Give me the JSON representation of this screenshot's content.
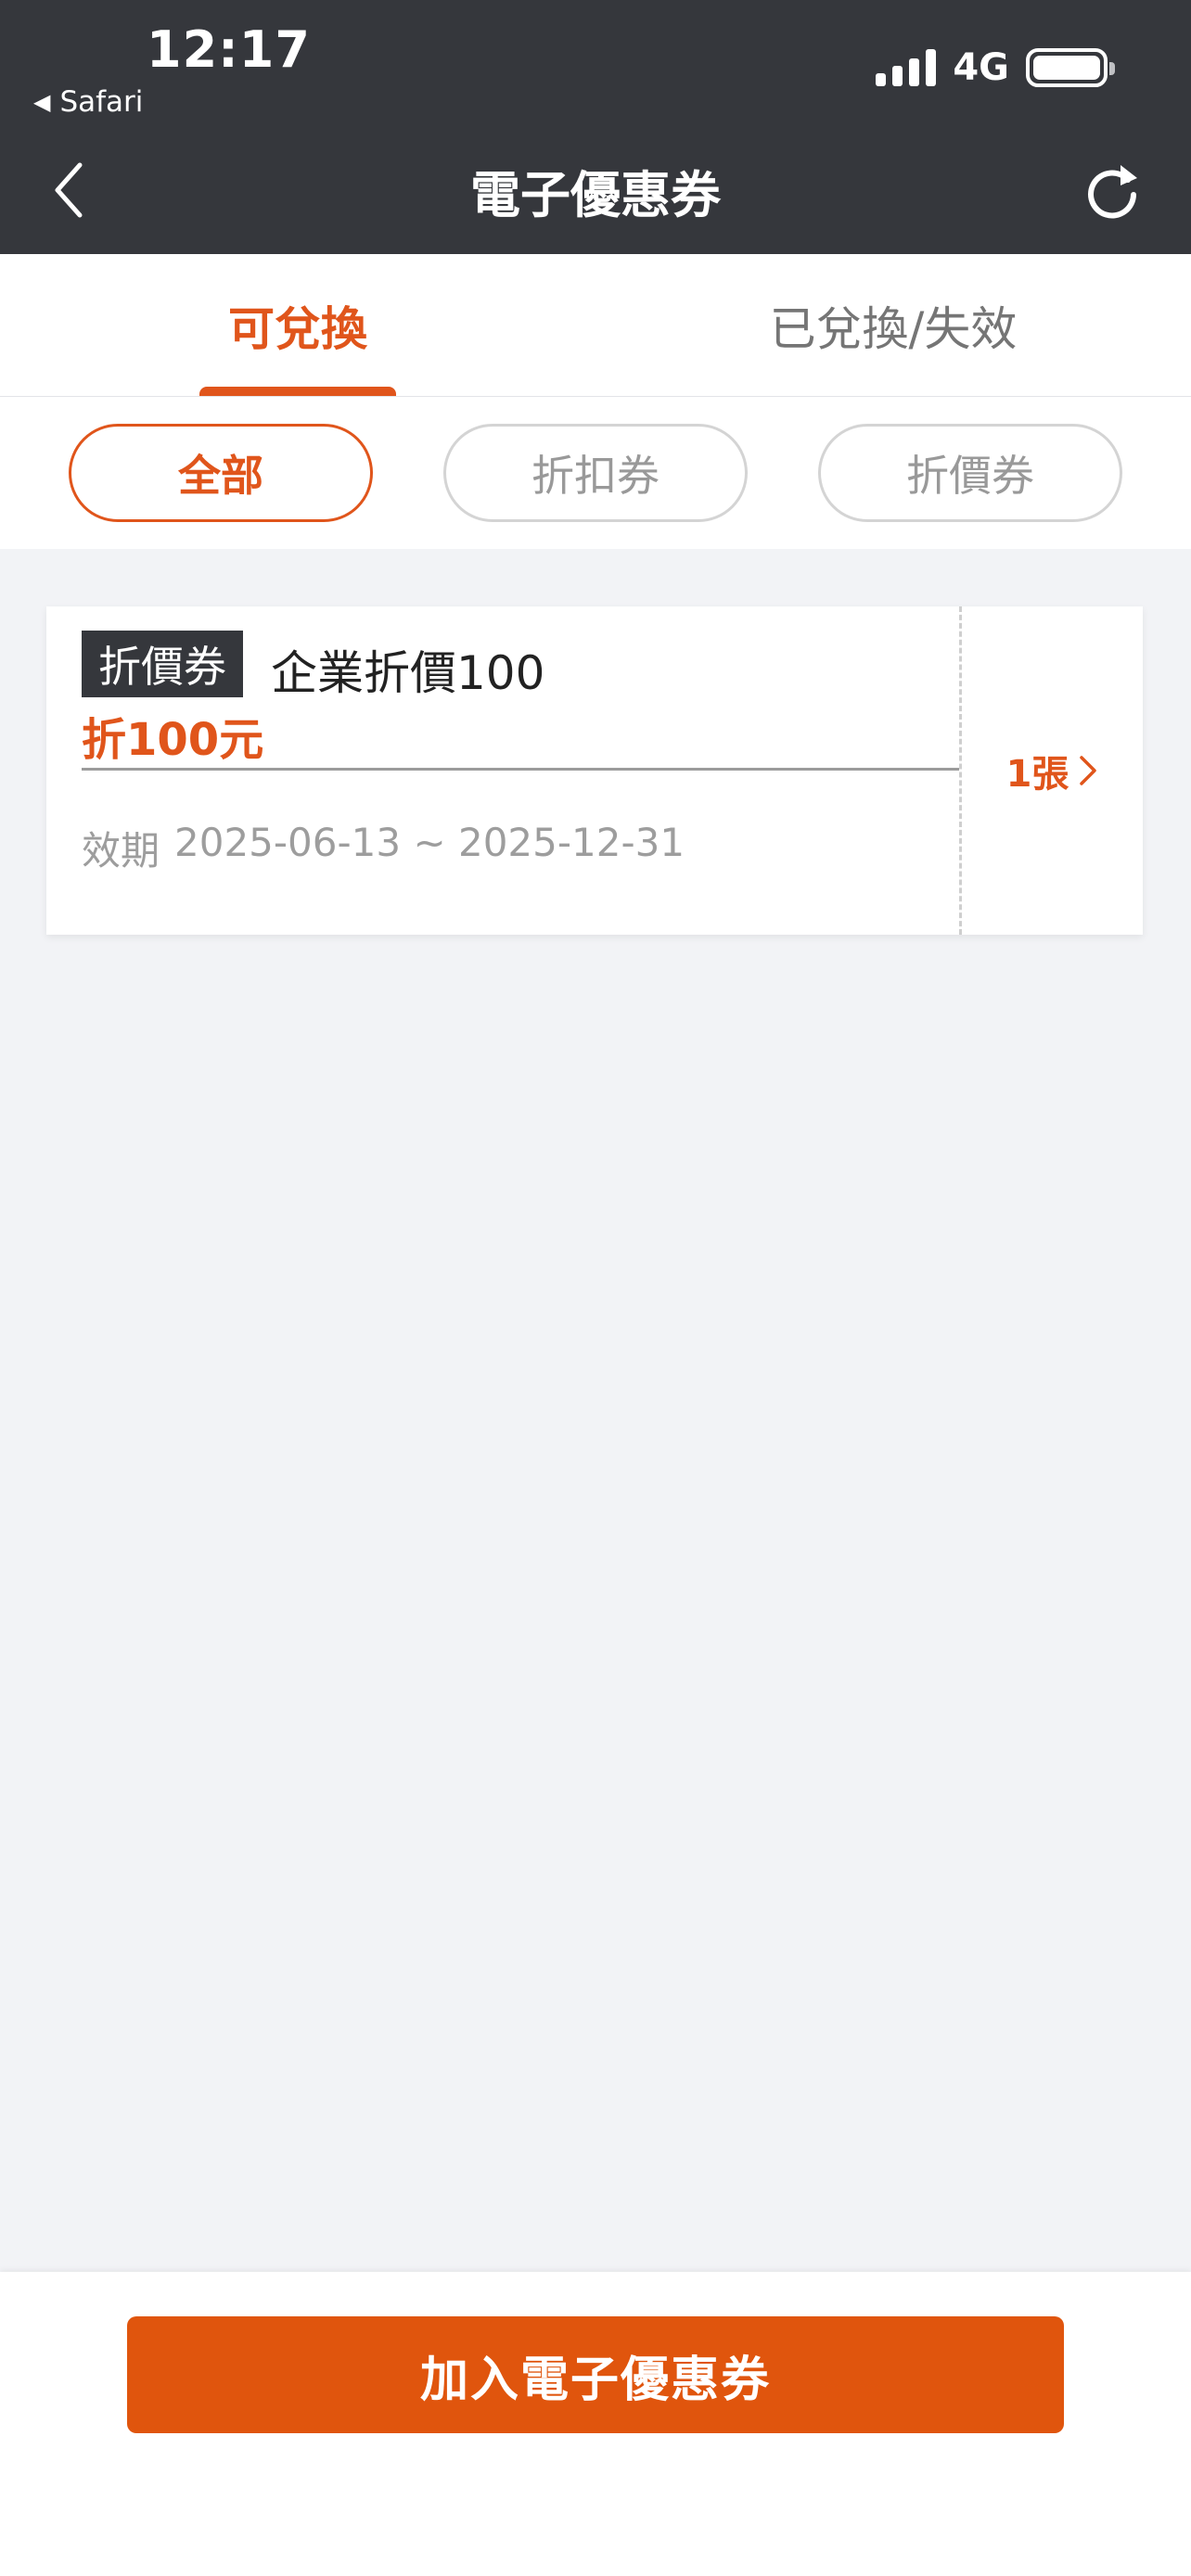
{
  "status_bar": {
    "time": "12:17",
    "back_app": "Safari",
    "network": "4G"
  },
  "nav": {
    "title": "電子優惠券",
    "back_icon": "chevron-left-icon",
    "refresh_icon": "refresh-icon"
  },
  "tabs": [
    {
      "label": "可兌換",
      "active": true
    },
    {
      "label": "已兌換/失效",
      "active": false
    }
  ],
  "filters": [
    {
      "label": "全部",
      "active": true
    },
    {
      "label": "折扣券",
      "active": false
    },
    {
      "label": "折價券",
      "active": false
    }
  ],
  "coupons": [
    {
      "type": "折價券",
      "name": "企業折價100",
      "amount": "折100元",
      "validity_label": "效期",
      "validity_range": "2025-06-13 ~ 2025-12-31",
      "count": "1張"
    }
  ],
  "bottom": {
    "add_button_label": "加入電子優惠券"
  },
  "colors": {
    "accent": "#e0551b",
    "header_bg": "#35373c",
    "page_bg": "#f2f3f6"
  }
}
